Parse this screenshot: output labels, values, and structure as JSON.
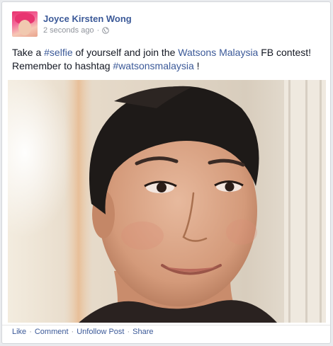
{
  "post": {
    "author": "Joyce Kirsten Wong",
    "timestamp": "2 seconds ago",
    "privacy_icon": "globe-icon",
    "message": {
      "part1": "Take a ",
      "hashtag1": "#selfie",
      "part2": " of yourself and join the ",
      "page_link": "Watsons Malaysia",
      "part3": " FB contest!",
      "part4": "Remember to hashtag ",
      "hashtag2": "#watsonsmalaysia",
      "part5": " !"
    },
    "actions": {
      "like": "Like",
      "comment": "Comment",
      "unfollow": "Unfollow Post",
      "share": "Share",
      "separator": "·"
    }
  },
  "colors": {
    "link": "#3b5998",
    "meta": "#90949c",
    "text": "#141823"
  }
}
